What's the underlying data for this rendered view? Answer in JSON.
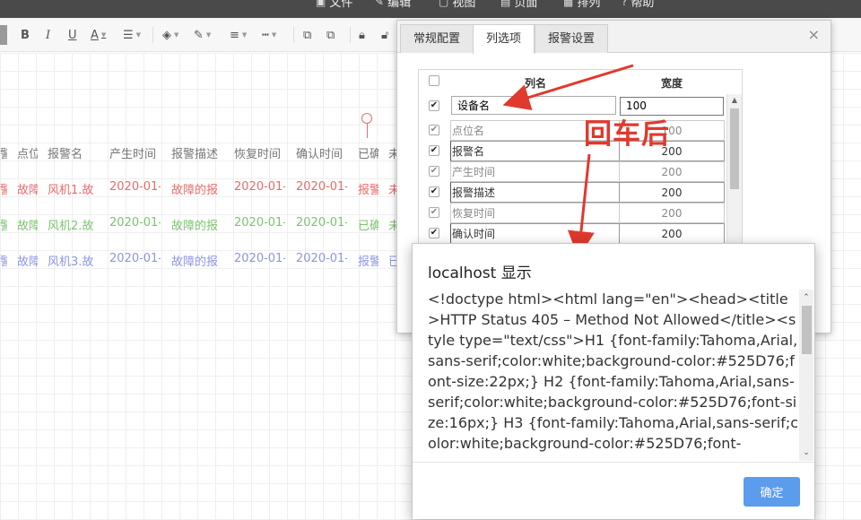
{
  "topbar": {
    "items": [
      {
        "label": "文件",
        "icon": "file-icon"
      },
      {
        "label": "编辑",
        "icon": "edit-icon"
      },
      {
        "label": "视图",
        "icon": "view-icon"
      },
      {
        "label": "页面",
        "icon": "page-icon"
      },
      {
        "label": "排列",
        "icon": "arrange-icon"
      },
      {
        "label": "帮助",
        "icon": "help-icon"
      }
    ]
  },
  "toolbar": {
    "bold": "B",
    "italic": "I",
    "underline": "U",
    "font_color": "A"
  },
  "grid": {
    "headers": [
      "警",
      "点位",
      "报警名",
      "产生时间",
      "报警描述",
      "恢复时间",
      "确认时间",
      "已确",
      "未"
    ],
    "rows": [
      {
        "cells": [
          "警",
          "故障",
          "风机1.故",
          "2020-01-",
          "故障的报",
          "2020-01-",
          "2020-01-",
          "报警",
          "未"
        ]
      },
      {
        "cells": [
          "警",
          "故障",
          "风机2.故",
          "2020-01-",
          "故障的报",
          "2020-01-",
          "2020-01-",
          "已确",
          "未"
        ]
      },
      {
        "cells": [
          "警",
          "故障",
          "风机3.故",
          "2020-01-",
          "故障的报",
          "2020-01-",
          "2020-01-",
          "报警",
          "已"
        ]
      }
    ]
  },
  "dialog": {
    "tabs": [
      {
        "label": "常规配置"
      },
      {
        "label": "列选项"
      },
      {
        "label": "报警设置"
      }
    ],
    "active_tab": "列选项",
    "close_label": "×",
    "columns_header": {
      "name": "列名",
      "width": "宽度"
    },
    "editing_row": {
      "name": "设备名",
      "width": "100"
    },
    "rows": [
      {
        "name": "点位名",
        "width": "100",
        "enabled": false
      },
      {
        "name": "报警名",
        "width": "200",
        "enabled": true
      },
      {
        "name": "产生时间",
        "width": "200",
        "enabled": false
      },
      {
        "name": "报警描述",
        "width": "200",
        "enabled": true
      },
      {
        "name": "恢复时间",
        "width": "200",
        "enabled": false
      },
      {
        "name": "确认时间",
        "width": "200",
        "enabled": true
      }
    ]
  },
  "annotation": {
    "text": "回车后",
    "color": "#e0392d"
  },
  "alert": {
    "title": "localhost 显示",
    "body": "<!doctype html><html lang=\"en\"><head><title>HTTP Status 405 – Method Not Allowed</title><style type=\"text/css\">H1 {font-family:Tahoma,Arial,sans-serif;color:white;background-color:#525D76;font-size:22px;} H2 {font-family:Tahoma,Arial,sans-serif;color:white;background-color:#525D76;font-size:16px;} H3 {font-family:Tahoma,Arial,sans-serif;color:white;background-color:#525D76;font-",
    "ok_label": "确定"
  },
  "colors": {
    "row_red": "#e96a6a",
    "row_green": "#7cc36f",
    "row_blue": "#8f94e3",
    "accent_button": "#5b9ced"
  }
}
